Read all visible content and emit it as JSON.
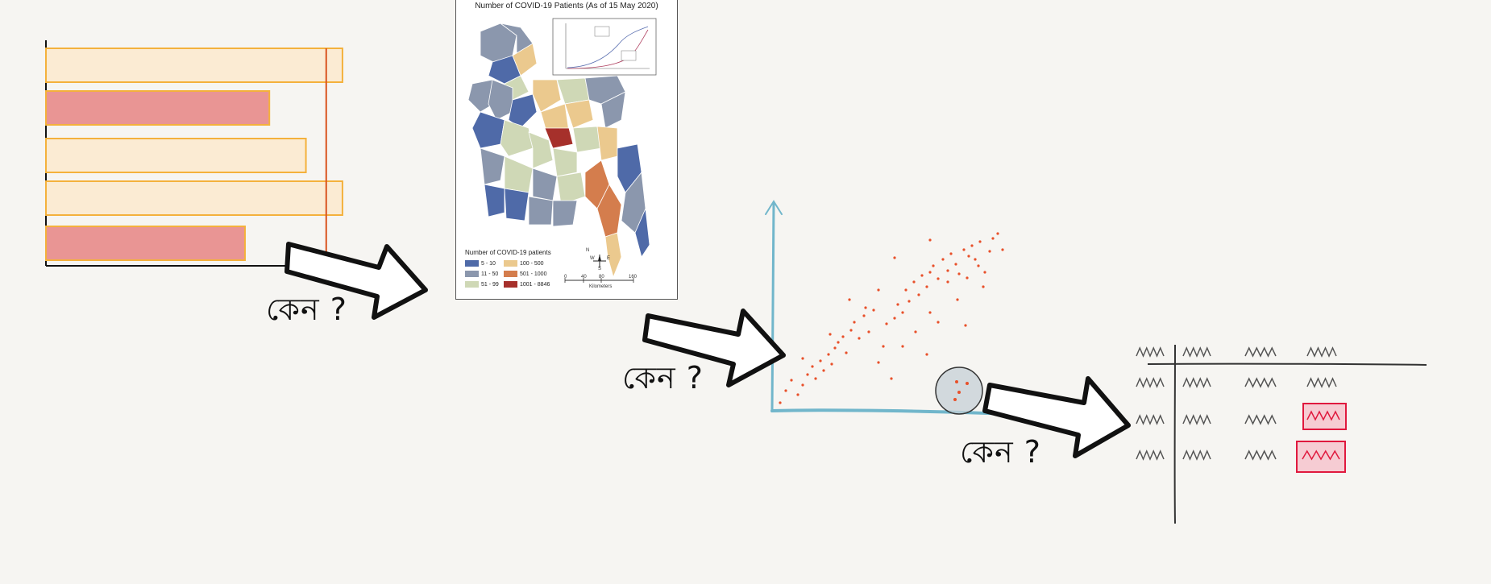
{
  "question_label": "কেন ?",
  "map": {
    "title": "Number of COVID-19 Patients (As of 15 May 2020)",
    "legend_title": "Number of COVID-19 patients",
    "legend": [
      {
        "label": "5 - 10",
        "color": "#4f6aa8"
      },
      {
        "label": "11 - 50",
        "color": "#8b97ad"
      },
      {
        "label": "51 - 99",
        "color": "#cfd8b6"
      },
      {
        "label": "100 - 500",
        "color": "#ebc98e"
      },
      {
        "label": "501 - 1000",
        "color": "#d47d4d"
      },
      {
        "label": "1001 - 8846",
        "color": "#a6302b"
      }
    ],
    "scale_ticks": [
      "0",
      "40",
      "80",
      "160"
    ],
    "scale_unit": "Kilometers",
    "compass": [
      "N",
      "W",
      "E",
      "S"
    ]
  },
  "bar_chart": {
    "bars": [
      {
        "value": 0.73,
        "highlight": false
      },
      {
        "value": 0.55,
        "highlight": true
      },
      {
        "value": 0.64,
        "highlight": false
      },
      {
        "value": 0.73,
        "highlight": false
      },
      {
        "value": 0.49,
        "highlight": true
      }
    ],
    "reference_line": 0.69,
    "fill_color": "#fbebd3",
    "highlight_color": "#e99594",
    "stroke_color": "#f4b13c",
    "reference_color": "#d9531e"
  },
  "scatter": {
    "axis_color": "#71b6cb",
    "dot_color": "#e8502a"
  },
  "table_sketch": {
    "highlight_color": "#e0193e"
  }
}
